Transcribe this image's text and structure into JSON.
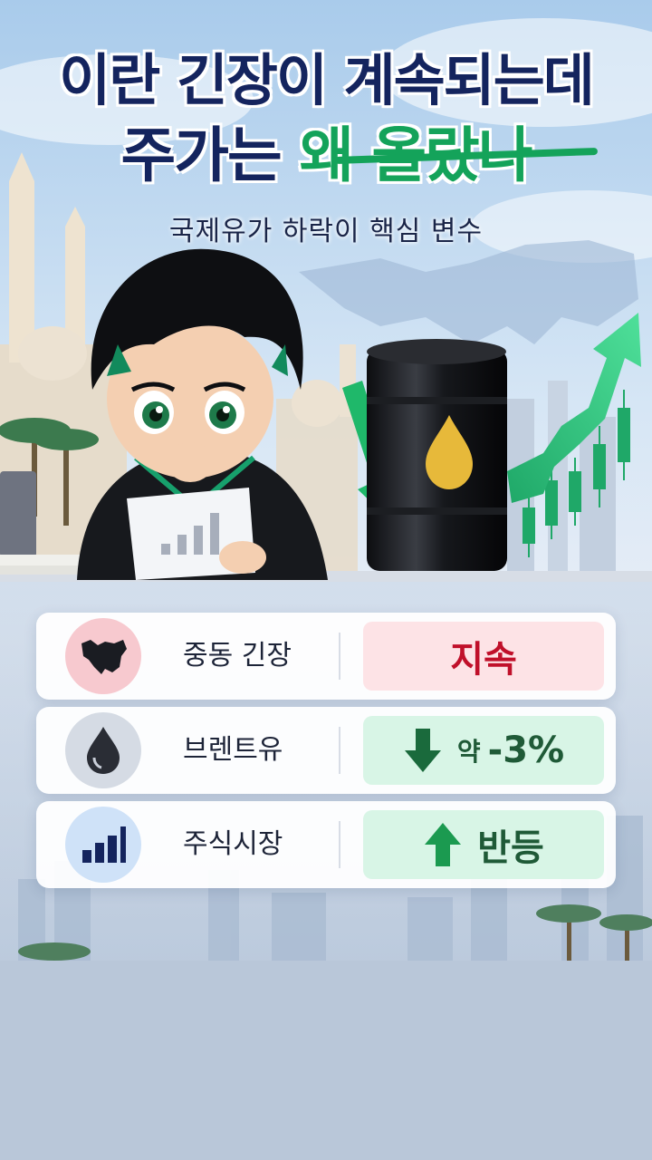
{
  "title": {
    "line1": "이란 긴장이 계속되는데",
    "line2_a": "주가는 ",
    "line2_b": "왜 올랐나"
  },
  "subtitle": "국제유가 하락이 핵심 변수",
  "rows": [
    {
      "label": "중동 긴장",
      "icon": "middle-east-map-icon",
      "value": "지속",
      "color": "#c0102a",
      "bg": "#fde3e6"
    },
    {
      "label": "브렌트유",
      "icon": "oil-drop-icon",
      "prefix": "약",
      "value": "-3%",
      "trend": "down",
      "color": "#1f5a37",
      "bg": "#d8f5e6"
    },
    {
      "label": "주식시장",
      "icon": "bar-chart-icon",
      "value": "반등",
      "trend": "up",
      "color": "#1f5a37",
      "bg": "#d8f5e6"
    }
  ],
  "colors": {
    "title": "#14245e",
    "accent": "#14a35a",
    "card_bg": "#ffffff"
  }
}
